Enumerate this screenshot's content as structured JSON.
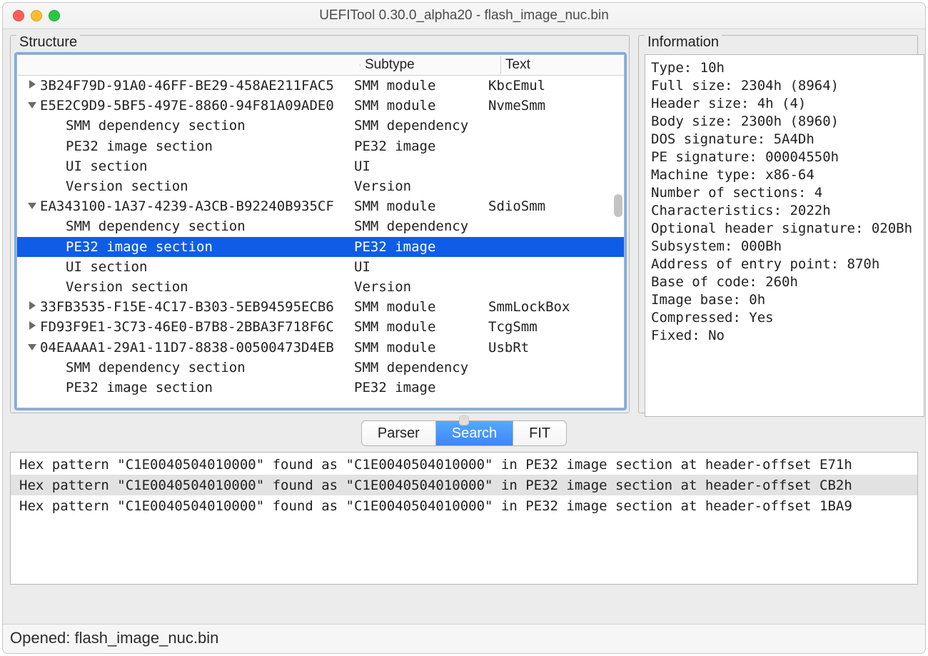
{
  "titlebar": {
    "title": "UEFITool 0.30.0_alpha20 - flash_image_nuc.bin"
  },
  "structure": {
    "title": "Structure",
    "columns": [
      "",
      "Subtype",
      "Text"
    ],
    "rows": [
      {
        "depth": 0,
        "arrow": "right",
        "name": "3B24F79D-91A0-46FF-BE29-458AE211FAC5",
        "subtype": "SMM module",
        "text": "KbcEmul"
      },
      {
        "depth": 0,
        "arrow": "down",
        "name": "E5E2C9D9-5BF5-497E-8860-94F81A09ADE0",
        "subtype": "SMM module",
        "text": "NvmeSmm"
      },
      {
        "depth": 1,
        "arrow": "",
        "name": "SMM dependency section",
        "subtype": "SMM dependency",
        "text": ""
      },
      {
        "depth": 1,
        "arrow": "",
        "name": "PE32 image section",
        "subtype": "PE32 image",
        "text": ""
      },
      {
        "depth": 1,
        "arrow": "",
        "name": "UI section",
        "subtype": "UI",
        "text": ""
      },
      {
        "depth": 1,
        "arrow": "",
        "name": "Version section",
        "subtype": "Version",
        "text": ""
      },
      {
        "depth": 0,
        "arrow": "down",
        "name": "EA343100-1A37-4239-A3CB-B92240B935CF",
        "subtype": "SMM module",
        "text": "SdioSmm"
      },
      {
        "depth": 1,
        "arrow": "",
        "name": "SMM dependency section",
        "subtype": "SMM dependency",
        "text": ""
      },
      {
        "depth": 1,
        "arrow": "",
        "name": "PE32 image section",
        "subtype": "PE32 image",
        "text": "",
        "selected": true
      },
      {
        "depth": 1,
        "arrow": "",
        "name": "UI section",
        "subtype": "UI",
        "text": ""
      },
      {
        "depth": 1,
        "arrow": "",
        "name": "Version section",
        "subtype": "Version",
        "text": ""
      },
      {
        "depth": 0,
        "arrow": "right",
        "name": "33FB3535-F15E-4C17-B303-5EB94595ECB6",
        "subtype": "SMM module",
        "text": "SmmLockBox"
      },
      {
        "depth": 0,
        "arrow": "right",
        "name": "FD93F9E1-3C73-46E0-B7B8-2BBA3F718F6C",
        "subtype": "SMM module",
        "text": "TcgSmm"
      },
      {
        "depth": 0,
        "arrow": "down",
        "name": "04EAAAA1-29A1-11D7-8838-00500473D4EB",
        "subtype": "SMM module",
        "text": "UsbRt"
      },
      {
        "depth": 1,
        "arrow": "",
        "name": "SMM dependency section",
        "subtype": "SMM dependency",
        "text": ""
      },
      {
        "depth": 1,
        "arrow": "",
        "name": "PE32 image section",
        "subtype": "PE32 image",
        "text": ""
      }
    ]
  },
  "information": {
    "title": "Information",
    "lines": [
      "Type: 10h",
      "Full size: 2304h (8964)",
      "Header size: 4h (4)",
      "Body size: 2300h (8960)",
      "DOS signature: 5A4Dh",
      "PE signature: 00004550h",
      "Machine type: x86-64",
      "Number of sections: 4",
      "Characteristics: 2022h",
      "Optional header signature: 020Bh",
      "Subsystem: 000Bh",
      "Address of entry point: 870h",
      "Base of code: 260h",
      "Image base: 0h",
      "Compressed: Yes",
      "Fixed: No"
    ]
  },
  "tabs": [
    "Parser",
    "Search",
    "FIT"
  ],
  "search_results": [
    {
      "text": "Hex pattern \"C1E0040504010000\" found as \"C1E0040504010000\" in PE32 image section at header-offset E71h",
      "selected": false
    },
    {
      "text": "Hex pattern \"C1E0040504010000\" found as \"C1E0040504010000\" in PE32 image section at header-offset CB2h",
      "selected": true
    },
    {
      "text": "Hex pattern \"C1E0040504010000\" found as \"C1E0040504010000\" in PE32 image section at header-offset 1BA9",
      "selected": false
    }
  ],
  "statusbar": {
    "text": "Opened: flash_image_nuc.bin"
  }
}
